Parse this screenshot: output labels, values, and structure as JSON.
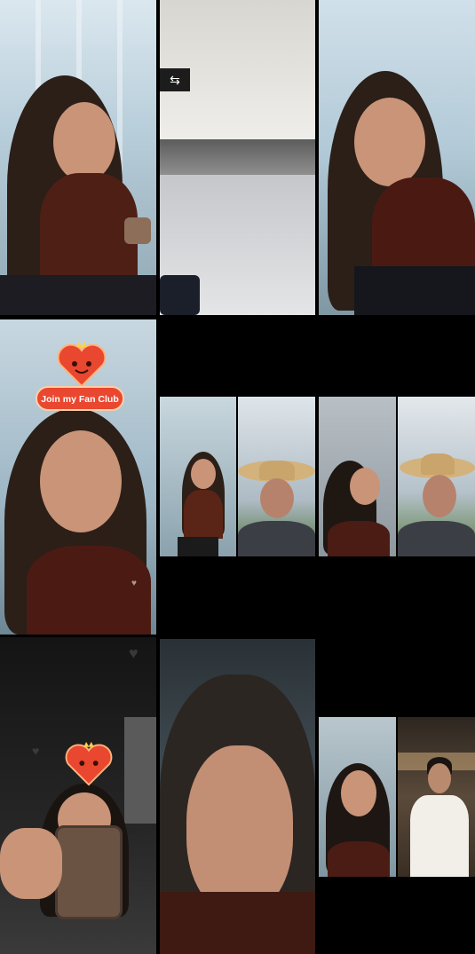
{
  "fanclub": {
    "label": "Join my Fan Club",
    "color": "#e9472f"
  },
  "tiles": [
    {
      "name": "tile-woman-phone-terminal"
    },
    {
      "name": "tile-airport-baggage-claim"
    },
    {
      "name": "tile-woman-leaning-terminal"
    },
    {
      "name": "tile-woman-fanclub-live"
    },
    {
      "name": "tile-duet-woman-terminal"
    },
    {
      "name": "tile-duet-man-cowboy-hat"
    },
    {
      "name": "tile-duet-woman-profile"
    },
    {
      "name": "tile-duet-man-cowboy-hat-2"
    },
    {
      "name": "tile-woman-car-phone"
    },
    {
      "name": "tile-woman-closeup"
    },
    {
      "name": "tile-duet-woman-smiling"
    },
    {
      "name": "tile-duet-man-white-shirt"
    }
  ]
}
